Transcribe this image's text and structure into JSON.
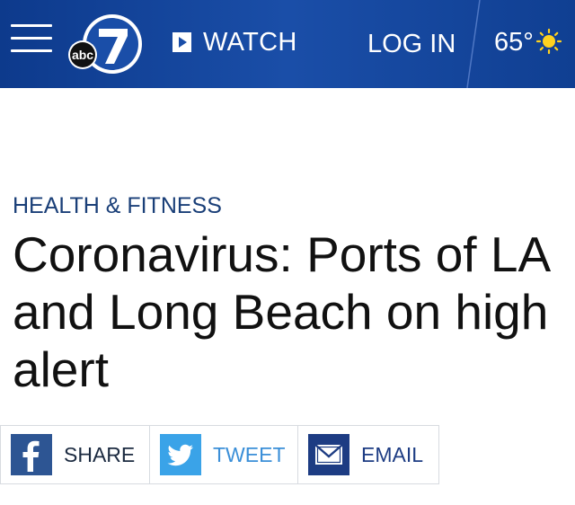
{
  "header": {
    "logo_text": "abc",
    "logo_number": "7",
    "watch_label": "WATCH",
    "login_label": "LOG IN",
    "temperature": "65°",
    "weather_icon": "sun-icon"
  },
  "article": {
    "category": "HEALTH & FITNESS",
    "title": "Coronavirus: Ports of LA and Long Beach on high alert"
  },
  "share": {
    "facebook_label": "SHARE",
    "twitter_label": "TWEET",
    "email_label": "EMAIL"
  },
  "colors": {
    "header_bg": "#1a4ea8",
    "category_text": "#1a3f78",
    "facebook": "#2d5593",
    "twitter": "#3aa3e8",
    "email": "#1d3c83"
  }
}
